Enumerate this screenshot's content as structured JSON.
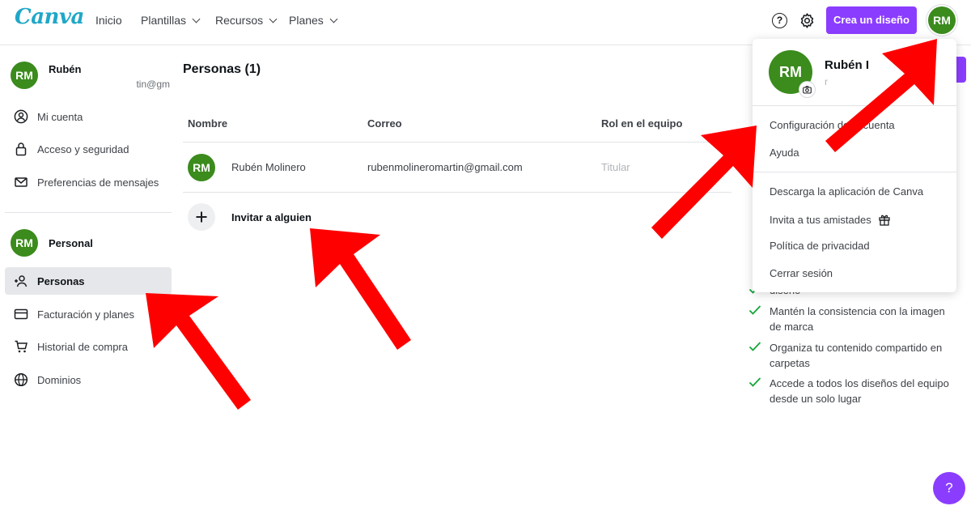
{
  "header": {
    "logo": "Canva",
    "nav": [
      {
        "label": "Inicio",
        "dropdown": false
      },
      {
        "label": "Plantillas",
        "dropdown": true
      },
      {
        "label": "Recursos",
        "dropdown": true
      },
      {
        "label": "Planes",
        "dropdown": true
      }
    ],
    "help_icon": "?",
    "create_label": "Crea un diseño",
    "avatar_initials": "RM"
  },
  "sidebar": {
    "user": {
      "initials": "RM",
      "name": "Rubén",
      "email": "tin@gm"
    },
    "account_items": [
      {
        "label": "Mi cuenta",
        "icon": "user-icon"
      },
      {
        "label": "Acceso y seguridad",
        "icon": "lock-icon"
      },
      {
        "label": "Preferencias de mensajes",
        "icon": "mail-icon"
      }
    ],
    "team": {
      "initials": "RM",
      "name": "Personal"
    },
    "team_items": [
      {
        "label": "Personas",
        "icon": "people-icon",
        "active": true
      },
      {
        "label": "Facturación y planes",
        "icon": "credit-card-icon",
        "active": false
      },
      {
        "label": "Historial de compra",
        "icon": "cart-icon",
        "active": false
      },
      {
        "label": "Dominios",
        "icon": "globe-icon",
        "active": false
      }
    ]
  },
  "main": {
    "title": "Personas (1)",
    "columns": [
      "Nombre",
      "Correo",
      "Rol en el equipo"
    ],
    "rows": [
      {
        "initials": "RM",
        "name": "Rubén Molinero",
        "email": "rubenmolineromartin@gmail.com",
        "role": "Titular"
      }
    ],
    "invite_label": "Invitar a alguien"
  },
  "features": [
    {
      "text": "diseño"
    },
    {
      "text": "Mantén la consistencia con la imagen de marca"
    },
    {
      "text": "Organiza tu contenido compartido en carpetas"
    },
    {
      "text": "Accede a todos los diseños del equipo desde un solo lugar"
    }
  ],
  "menu": {
    "initials": "RM",
    "name": "Rubén I",
    "email": "r",
    "email_tail": "@",
    "items_top": [
      "Configuración de la cuenta",
      "Ayuda"
    ],
    "items_bottom": [
      "Descarga la aplicación de Canva",
      "Invita a tus amistades",
      "Política de privacidad",
      "Cerrar sesión"
    ]
  },
  "help_fab": "?",
  "colors": {
    "brand_purple": "#8b3dff",
    "avatar_green": "#3b8b1d",
    "annotation_red": "#ff0000",
    "check_green": "#13a538"
  }
}
